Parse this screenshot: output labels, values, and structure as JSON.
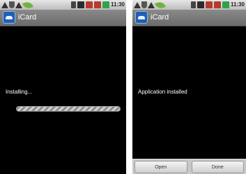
{
  "screens": [
    {
      "status_bar": {
        "time": "11:30"
      },
      "title_bar": {
        "app_name": "iCard"
      },
      "message": "Installing...",
      "progress": {
        "state": "indeterminate"
      }
    },
    {
      "status_bar": {
        "time": "11:30"
      },
      "title_bar": {
        "app_name": "iCard"
      },
      "message": "Application installed",
      "buttons": {
        "open": "Open",
        "done": "Done"
      }
    }
  ],
  "colors": {
    "screen_background": "#000000",
    "title_bar": "#7a7a7a",
    "status_bar": "#cfcfcf",
    "app_icon": "#1f5fb5"
  },
  "icons": [
    "warning-icon",
    "shield-icon",
    "leaf-icon",
    "bluetooth-icon",
    "multimedia-icon",
    "calendar-icon",
    "battery-icon"
  ]
}
